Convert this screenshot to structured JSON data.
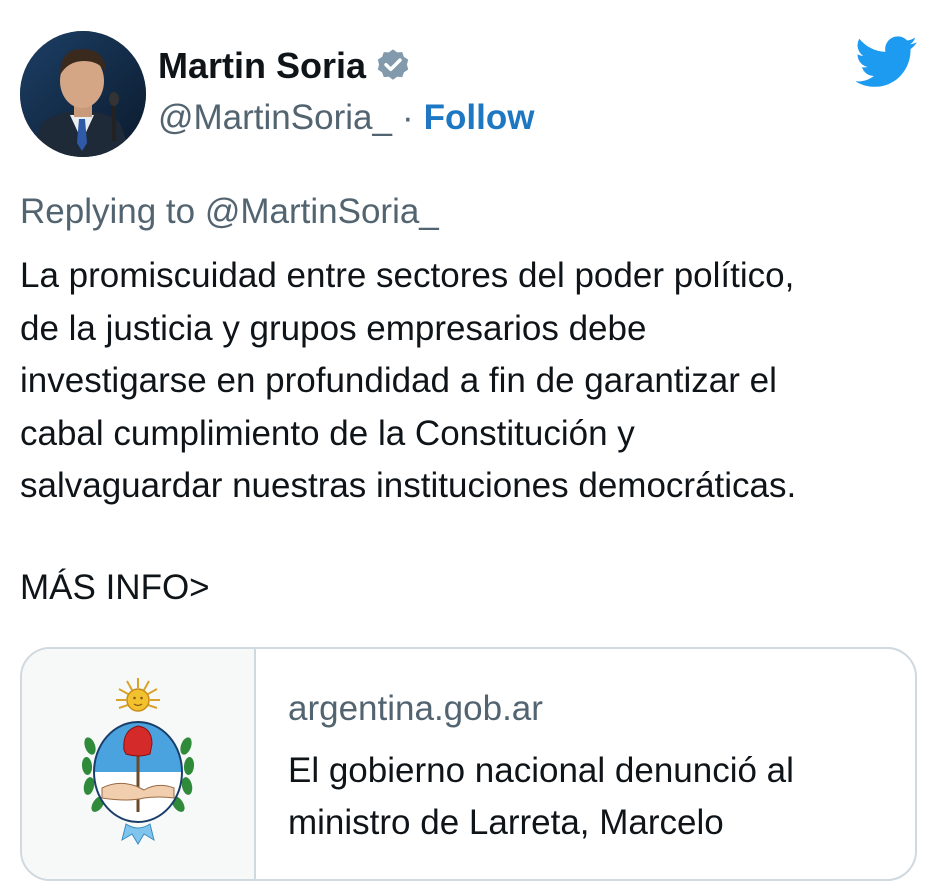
{
  "author": {
    "name": "Martin Soria",
    "handle": "@MartinSoria_",
    "separator": "·",
    "follow_label": "Follow",
    "verified": true,
    "avatar_icon": "profile-photo"
  },
  "platform_icon": "twitter-bird-icon",
  "colors": {
    "accent": "#1d9bf0",
    "follow": "#1d77c2",
    "secondary_text": "#536471",
    "border": "#cfd9de"
  },
  "tweet": {
    "replying_to": "Replying to @MartinSoria_",
    "text": "La promiscuidad entre sectores del poder político,\nde la justicia y grupos empresarios debe\ninvestigarse en profundidad a fin de garantizar el\ncabal cumplimiento de la Constitución y\nsalvaguardar nuestras instituciones democráticas.",
    "more_info": "MÁS INFO>"
  },
  "link_card": {
    "thumbnail_icon": "argentina-coat-of-arms-icon",
    "domain": "argentina.gob.ar",
    "title": "El gobierno nacional denunció al ministro de Larreta, Marcelo"
  }
}
